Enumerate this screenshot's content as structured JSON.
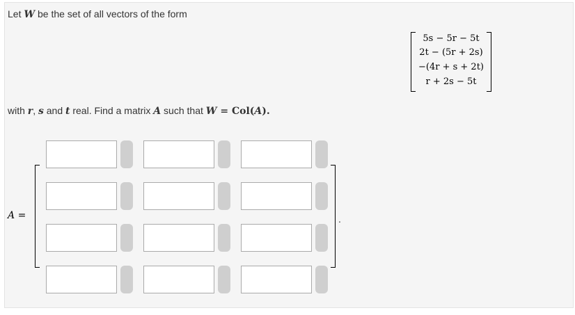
{
  "problem": {
    "intro_text": "Let W be the set of all vectors of the form",
    "intro": {
      "before": "Let ",
      "var": "W",
      "after": " be the set of all vectors of the form"
    },
    "vector_entries": [
      "5s − 5r − 5t",
      "2t − (5r + 2s)",
      "−(4r + s + 2t)",
      "r + 2s − 5t"
    ],
    "condition": {
      "p1": "with ",
      "r": "r",
      "comma": ", ",
      "s": "s",
      "and": " and ",
      "t": "t",
      "p2": " real. Find a matrix ",
      "A": "A",
      "p3": " such that ",
      "W": "W",
      "eq": " = Col(",
      "A2": "A",
      "close": ")."
    }
  },
  "matrix": {
    "label_var": "A",
    "label_eq": " =",
    "rows": 4,
    "cols": 3,
    "cells": [
      [
        "",
        "",
        ""
      ],
      [
        "",
        "",
        ""
      ],
      [
        "",
        "",
        ""
      ],
      [
        "",
        "",
        ""
      ]
    ],
    "trailing": "."
  }
}
